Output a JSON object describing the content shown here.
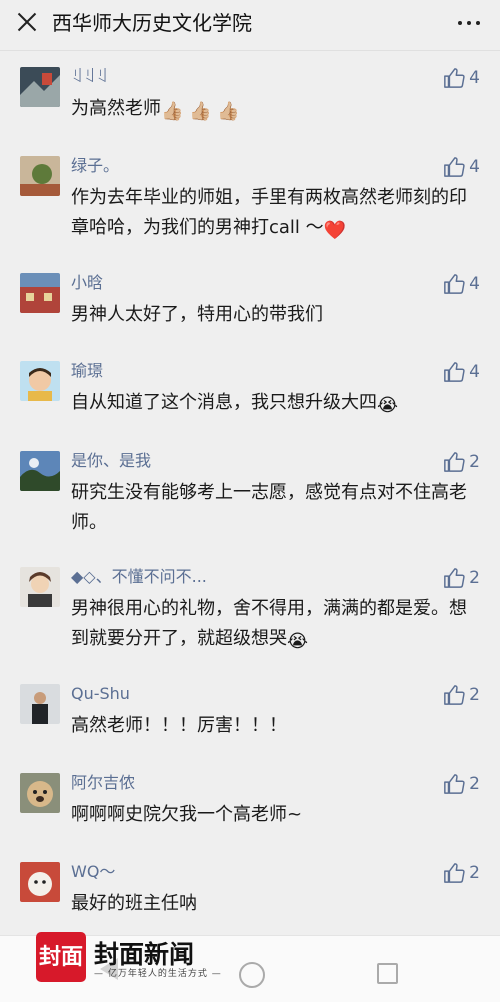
{
  "header": {
    "title": "西华师大历史文化学院"
  },
  "comments": [
    {
      "name": "ꆹꆹꆹ",
      "text": "为高然老师",
      "emoji": "👍🏼 👍🏼 👍🏼",
      "likes": "4"
    },
    {
      "name": "绿子。",
      "text": "作为去年毕业的师姐，手里有两枚高然老师刻的印章哈哈，为我们的男神打call ～",
      "emoji": "❤️",
      "likes": "4"
    },
    {
      "name": "小晗",
      "text": "男神人太好了，特用心的带我们",
      "emoji": "",
      "likes": "4"
    },
    {
      "name": "瑜璟",
      "text": "自从知道了这个消息，我只想升级大四",
      "emoji": "😭",
      "likes": "4"
    },
    {
      "name": "是你、是我",
      "text": "研究生没有能够考上一志愿，感觉有点对不住高老师。",
      "emoji": "",
      "likes": "2"
    },
    {
      "name": "◆◇、不懂不问不...",
      "text": "男神很用心的礼物，舍不得用，满满的都是爱。想到就要分开了，就超级想哭",
      "emoji": "😭",
      "likes": "2"
    },
    {
      "name": "Qu-Shu",
      "text": "高然老师！！！厉害！！！",
      "emoji": "",
      "likes": "2"
    },
    {
      "name": "阿尔吉侬",
      "text": "啊啊啊史院欠我一个高老师~",
      "emoji": "",
      "likes": "2"
    },
    {
      "name": "WQ～",
      "text": "最好的班主任呐",
      "emoji": "",
      "likes": "2"
    }
  ],
  "footer": {
    "logo_char": "封面",
    "brand": "封面新闻",
    "slogan": "— 亿万年轻人的生活方式 —"
  },
  "icons": {
    "close": "close-icon",
    "more": "more-dots-icon",
    "like": "thumbs-up-icon"
  }
}
